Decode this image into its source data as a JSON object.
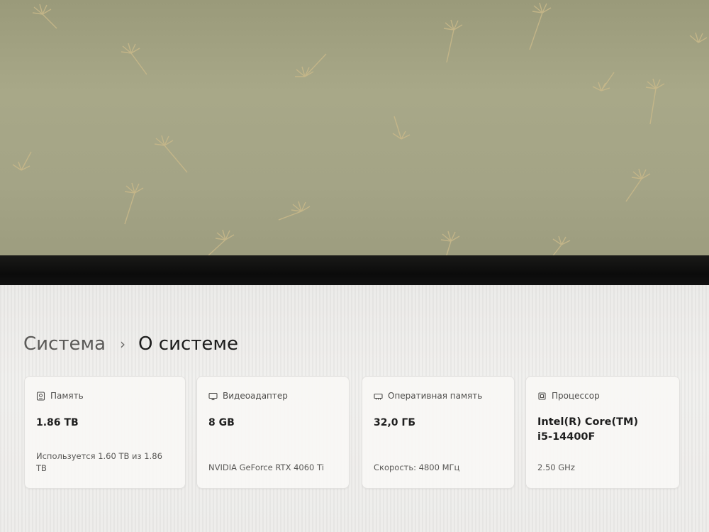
{
  "breadcrumb": {
    "parent": "Система",
    "separator": "›",
    "current": "О системе"
  },
  "cards": [
    {
      "icon": "storage-icon",
      "title": "Память",
      "value": "1.86 TB",
      "detail_line1": "Используется 1.60 TB из 1.86",
      "detail_line2": "TB"
    },
    {
      "icon": "gpu-icon",
      "title": "Видеоадаптер",
      "value": "8 GB",
      "detail_line1": "NVIDIA GeForce RTX 4060 Ti"
    },
    {
      "icon": "ram-icon",
      "title": "Оперативная память",
      "value": "32,0 ГБ",
      "detail_line1": "Скорость: 4800 МГц"
    },
    {
      "icon": "cpu-icon",
      "title": "Процессор",
      "value_line1": "Intel(R) Core(TM)",
      "value_line2": "i5-14400F",
      "detail_line1": "2.50 GHz"
    }
  ]
}
